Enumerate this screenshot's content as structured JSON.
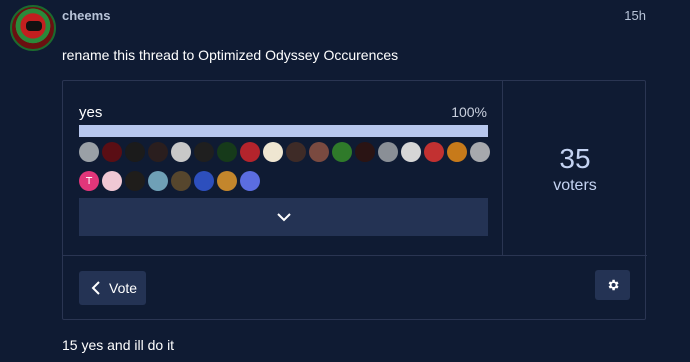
{
  "post": {
    "username": "cheems",
    "time": "15h",
    "body": "rename this thread to Optimized Odyssey Occurences",
    "avatar_icon": "red-character-avatar"
  },
  "poll": {
    "option_label": "yes",
    "option_percent": "100%",
    "option_fraction": 1.0,
    "voter_count": "35",
    "voter_label": "voters",
    "expand_icon": "chevron-down-icon",
    "vote_button_label": "Vote",
    "vote_button_icon": "chevron-left-icon",
    "settings_icon": "gear-icon",
    "voter_avatars_row1": [
      {
        "color": "#9aa0a6"
      },
      {
        "color": "#5a0e14"
      },
      {
        "color": "#1b1b1b"
      },
      {
        "color": "#2a1e1e"
      },
      {
        "color": "#c8c8c8"
      },
      {
        "color": "#1f1f1f"
      },
      {
        "color": "#163a1a"
      },
      {
        "color": "#b4242c"
      },
      {
        "color": "#efe6d1"
      },
      {
        "color": "#3e2b27"
      },
      {
        "color": "#7a4a40"
      },
      {
        "color": "#2f7a2a"
      },
      {
        "color": "#2a1414"
      },
      {
        "color": "#8a8f96"
      },
      {
        "color": "#d6d6d6"
      },
      {
        "color": "#c23131"
      },
      {
        "color": "#c77a1a"
      },
      {
        "color": "#a7a9ad"
      }
    ],
    "voter_avatars_row2": [
      {
        "color": "#e2367a",
        "letter": "T"
      },
      {
        "color": "#f0c8d4"
      },
      {
        "color": "#1f1d1b"
      },
      {
        "color": "#6fa0b6"
      },
      {
        "color": "#56462d"
      },
      {
        "color": "#2d4fbd"
      },
      {
        "color": "#c3862c"
      },
      {
        "color": "#5b6de0"
      }
    ]
  },
  "reply": {
    "body": "15 yes and ill do it"
  }
}
